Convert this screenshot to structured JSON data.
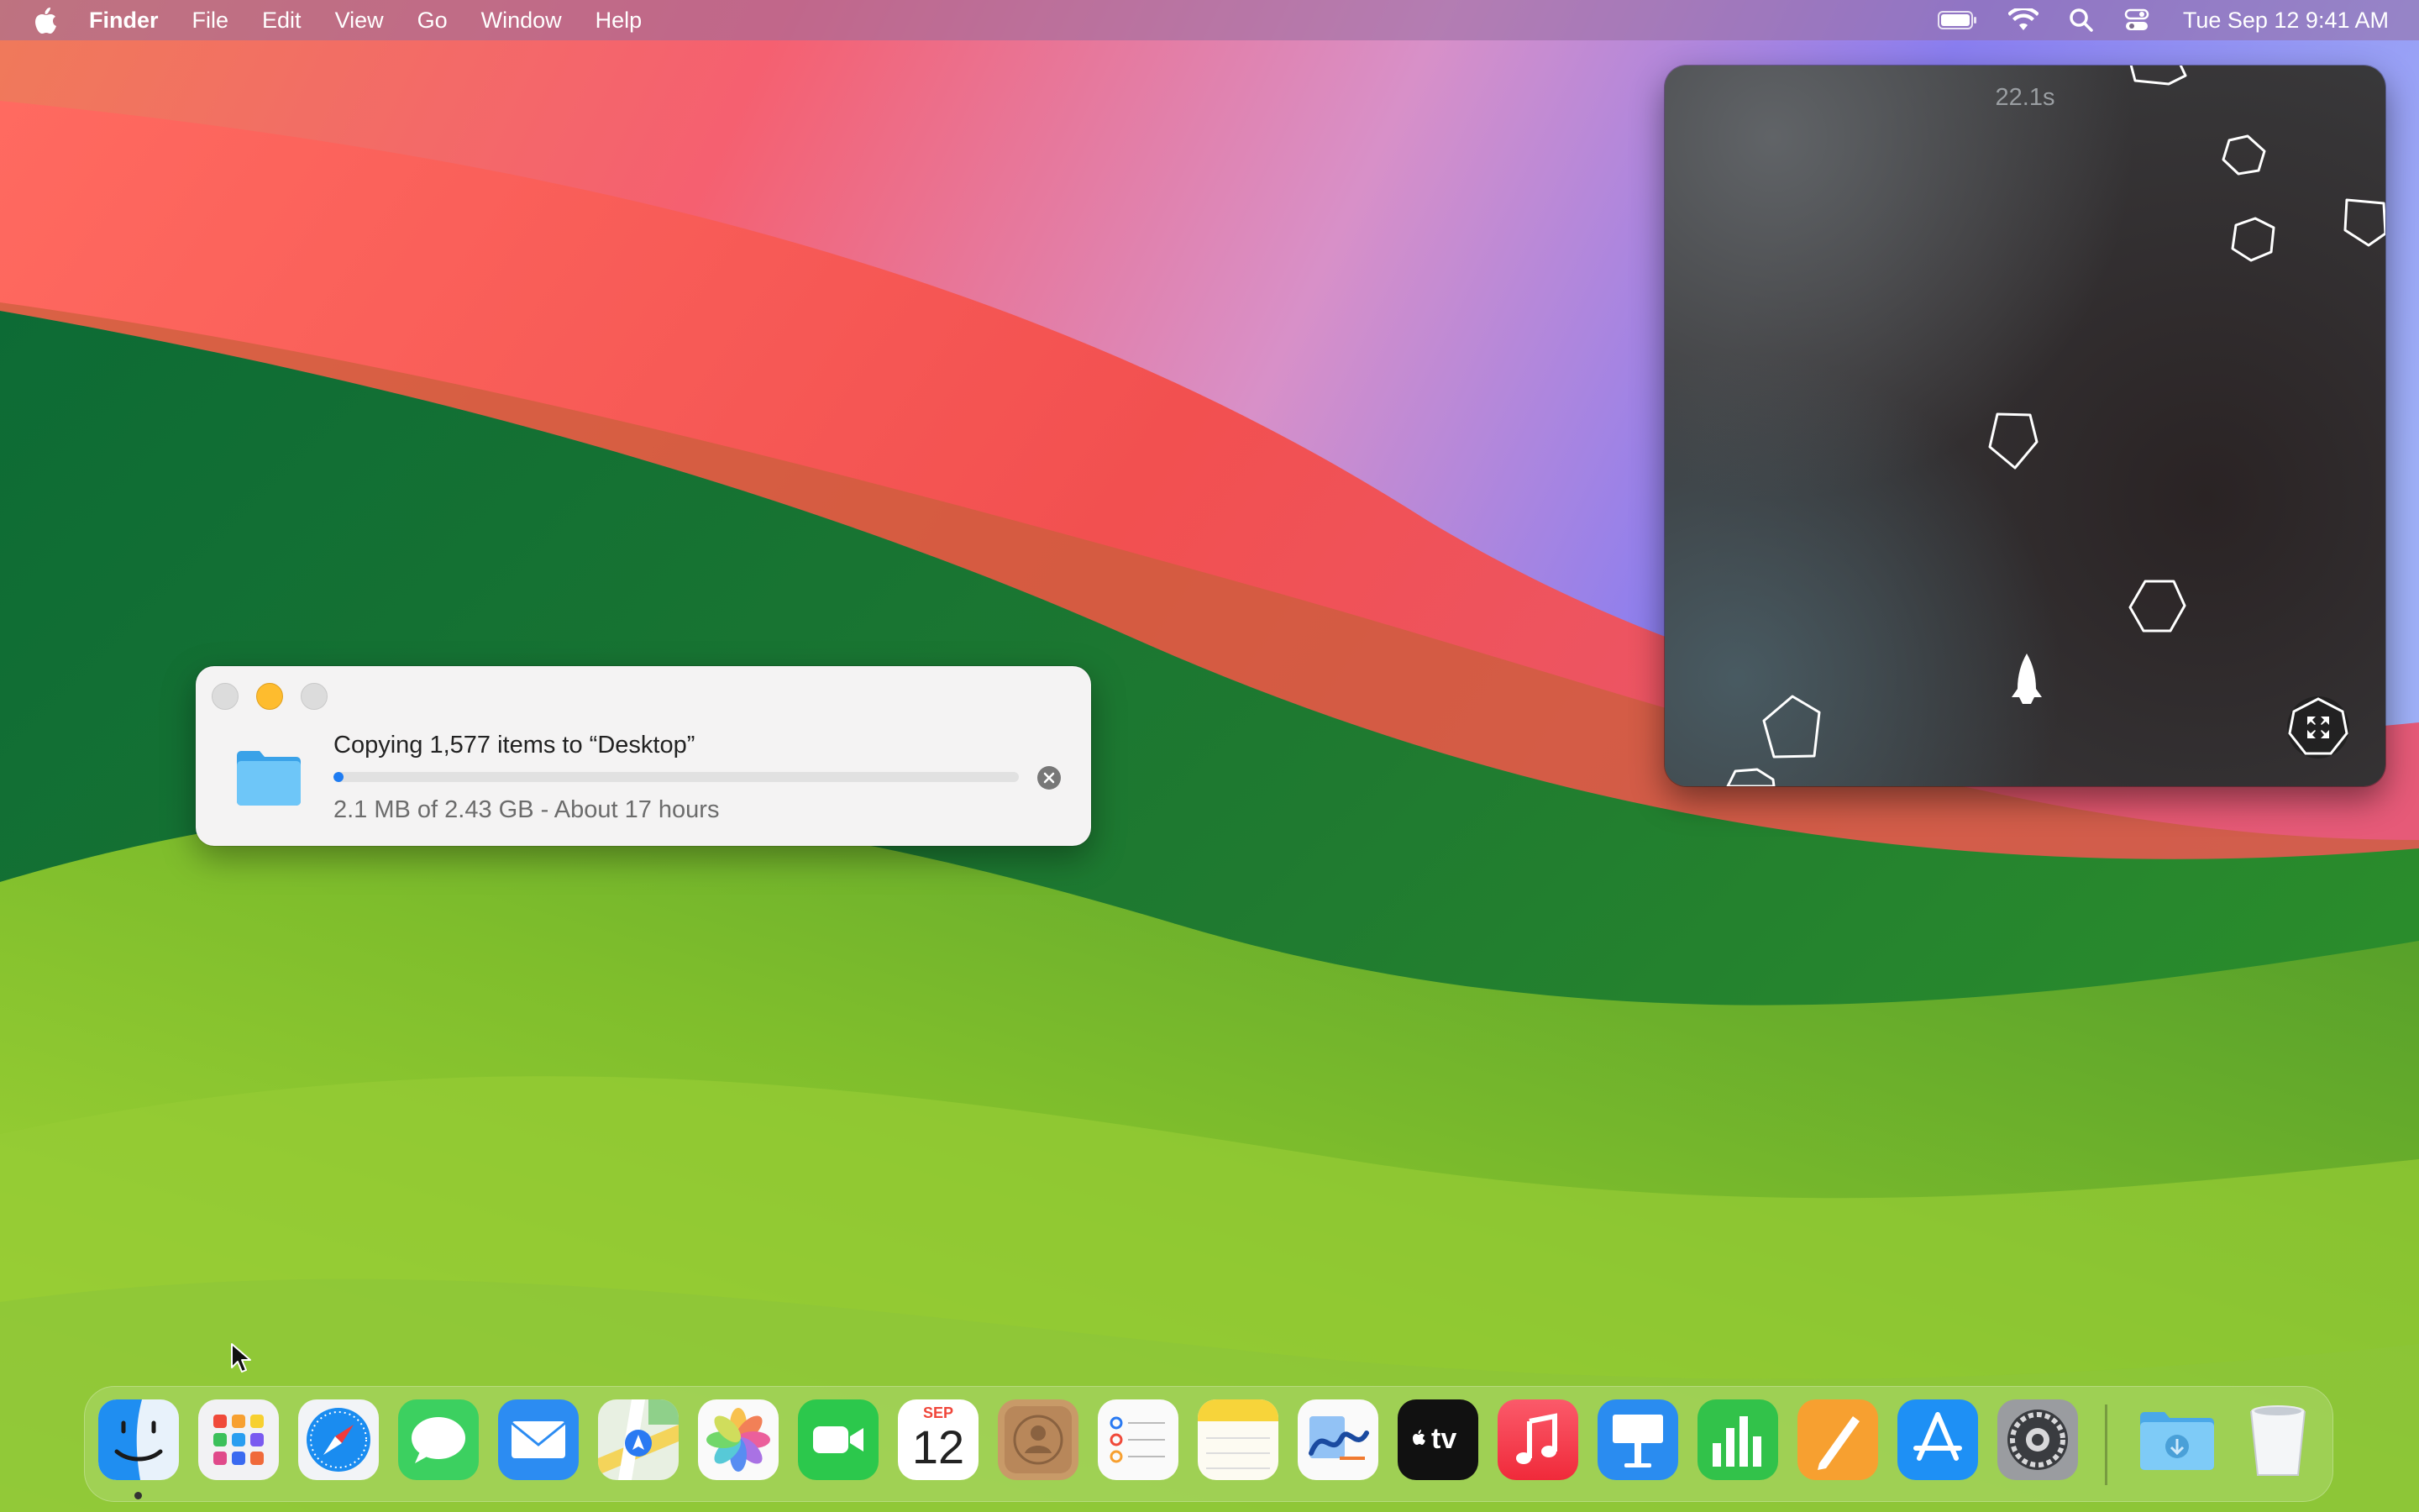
{
  "menubar": {
    "app_name": "Finder",
    "menus": [
      "File",
      "Edit",
      "View",
      "Go",
      "Window",
      "Help"
    ],
    "clock": "Tue Sep 12  9:41 AM",
    "icons": [
      "apple-icon",
      "battery-icon",
      "wifi-icon",
      "spotlight-search-icon",
      "control-center-icon"
    ]
  },
  "copy_dialog": {
    "title": "Copying 1,577 items to “Desktop”",
    "status": "2.1 MB of 2.43 GB - About 17 hours",
    "progress_fraction": 0.0009,
    "accent_color": "#1e7cf2"
  },
  "game": {
    "timer": "22.1s",
    "ship_icon": "rocket-ship-icon",
    "fullscreen_icon": "fullscreen-toggle-icon"
  },
  "dock": {
    "apps": [
      {
        "name": "Finder",
        "icon": "finder-icon",
        "running": true
      },
      {
        "name": "Launchpad",
        "icon": "launchpad-icon"
      },
      {
        "name": "Safari",
        "icon": "safari-icon"
      },
      {
        "name": "Messages",
        "icon": "messages-icon"
      },
      {
        "name": "Mail",
        "icon": "mail-icon"
      },
      {
        "name": "Maps",
        "icon": "maps-icon"
      },
      {
        "name": "Photos",
        "icon": "photos-icon"
      },
      {
        "name": "FaceTime",
        "icon": "facetime-icon"
      },
      {
        "name": "Calendar",
        "icon": "calendar-icon",
        "month": "SEP",
        "day": "12"
      },
      {
        "name": "Contacts",
        "icon": "contacts-icon"
      },
      {
        "name": "Reminders",
        "icon": "reminders-icon"
      },
      {
        "name": "Notes",
        "icon": "notes-icon"
      },
      {
        "name": "Freeform",
        "icon": "freeform-icon"
      },
      {
        "name": "TV",
        "icon": "apple-tv-icon",
        "label": "tv"
      },
      {
        "name": "Music",
        "icon": "music-icon"
      },
      {
        "name": "Keynote",
        "icon": "keynote-icon"
      },
      {
        "name": "Numbers",
        "icon": "numbers-icon"
      },
      {
        "name": "Pages",
        "icon": "pages-icon"
      },
      {
        "name": "App Store",
        "icon": "app-store-icon"
      },
      {
        "name": "System Settings",
        "icon": "system-settings-icon"
      }
    ],
    "stacks": [
      {
        "name": "Downloads",
        "icon": "downloads-folder-icon"
      },
      {
        "name": "Trash",
        "icon": "trash-icon"
      }
    ]
  }
}
